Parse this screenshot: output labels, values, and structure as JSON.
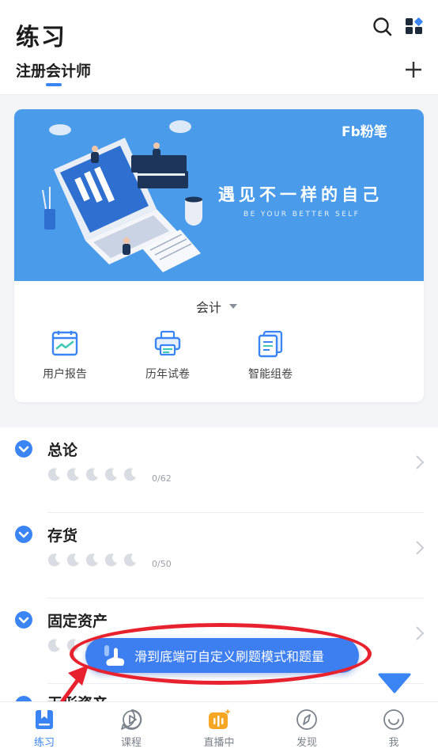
{
  "header": {
    "title": "练习",
    "subject_tab": "注册会计师"
  },
  "banner": {
    "logo": "Fb粉笔",
    "title": "遇见不一样的自己",
    "subtitle": "BE YOUR BETTER SELF"
  },
  "subject_select": {
    "value": "会计"
  },
  "tools": [
    {
      "label": "用户报告",
      "icon": "report-icon"
    },
    {
      "label": "历年试卷",
      "icon": "printer-icon"
    },
    {
      "label": "智能组卷",
      "icon": "paper-stack-icon"
    }
  ],
  "chapters": [
    {
      "title": "总论",
      "progress": "0/62"
    },
    {
      "title": "存货",
      "progress": "0/50"
    },
    {
      "title": "固定资产",
      "progress": ""
    },
    {
      "title": "无形资产",
      "progress": ""
    }
  ],
  "toast": {
    "text": "滑到底端可自定义刷题模式和题量"
  },
  "tabbar": {
    "items": [
      {
        "label": "练习",
        "icon": "practice-book-icon",
        "active": true
      },
      {
        "label": "课程",
        "icon": "play-circle-icon",
        "active": false
      },
      {
        "label": "直播中",
        "icon": "live-audio-icon",
        "active": false
      },
      {
        "label": "发现",
        "icon": "compass-icon",
        "active": false
      },
      {
        "label": "我",
        "icon": "smile-face-icon",
        "active": false
      }
    ]
  },
  "colors": {
    "accent": "#3b84f3",
    "banner": "#4a9bea",
    "live": "#f5a623",
    "annotation": "#e7222e"
  }
}
